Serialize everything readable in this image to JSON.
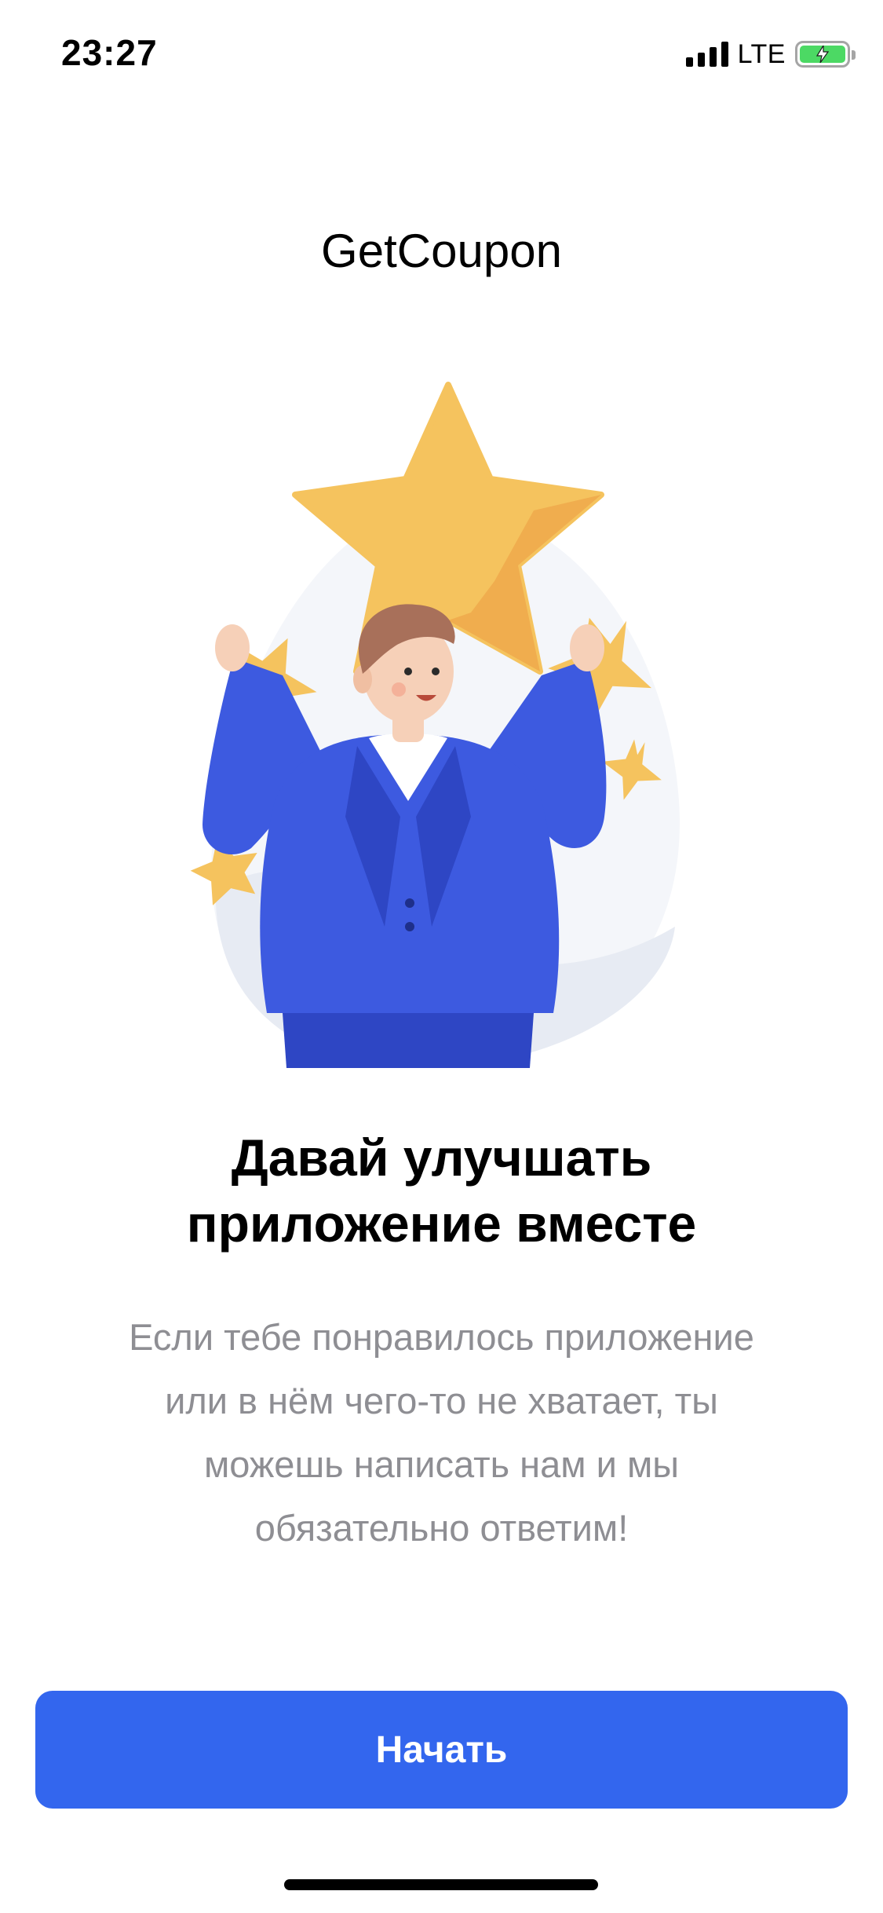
{
  "status_bar": {
    "time": "23:27",
    "network": "LTE",
    "signal_icon": "signal-bars-icon",
    "battery_icon": "battery-charging-icon",
    "battery_level": 1.0,
    "battery_color": "#4cd964"
  },
  "header": {
    "app_title": "GetCoupon"
  },
  "illustration": {
    "name": "man-holding-star-illustration",
    "colors": {
      "star": "#f5c35e",
      "star_shade": "#f0ad4e",
      "suit": "#3d5ae0",
      "suit_dark": "#2e46c4",
      "skin": "#f6d0b8",
      "hair": "#a8705a",
      "background_blob": "#f4f6fa"
    }
  },
  "content": {
    "headline_line1": "Давай улучшать",
    "headline_line2": "приложение вместе",
    "description_line1": "Если тебе понравилось приложение",
    "description_line2": "или в нём чего-то не хватает, ты",
    "description_line3": "можешь написать нам и мы",
    "description_line4": "обязательно ответим!"
  },
  "actions": {
    "start_label": "Начать",
    "start_color": "#3366ee"
  }
}
